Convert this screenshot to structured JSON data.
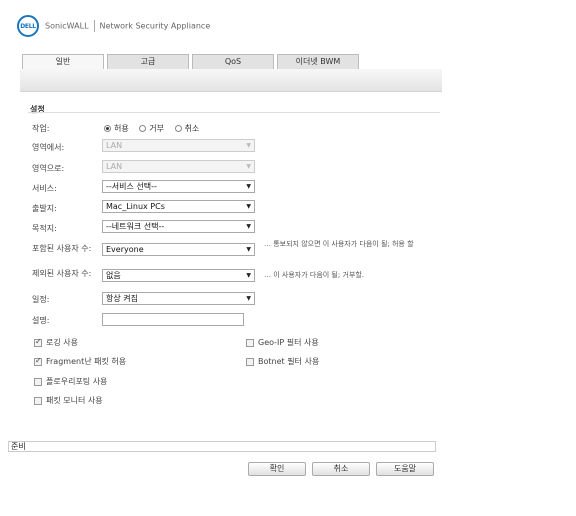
{
  "header": {
    "logo_text": "DELL",
    "brand": "SonicWALL",
    "product": "Network Security Appliance"
  },
  "tabs": [
    {
      "label": "일반"
    },
    {
      "label": "고급"
    },
    {
      "label": "QoS"
    },
    {
      "label": "이더넷 BWM"
    }
  ],
  "section": {
    "title": "설정"
  },
  "form": {
    "action": {
      "label": "작업:",
      "options": [
        "허용",
        "거부",
        "취소"
      ],
      "selected": "허용"
    },
    "from_zone": {
      "label": "영역에서:",
      "value": "LAN"
    },
    "to_zone": {
      "label": "영역으로:",
      "value": "LAN"
    },
    "service": {
      "label": "서비스:",
      "value": "--서비스 선택--"
    },
    "source": {
      "label": "출발지:",
      "value": "Mac_Linux PCs"
    },
    "destination": {
      "label": "목적지:",
      "value": "--네트워크 선택--"
    },
    "users_included": {
      "label": "포함된 사용자 수:",
      "value": "Everyone",
      "hint": "… 통보되지 않으면 이 사용자가 다음이 될; 허용 할"
    },
    "users_excluded": {
      "label": "제외된 사용자 수:",
      "value": "없음",
      "hint": "… 이 사용자가 다음이 될; 거부할."
    },
    "schedule": {
      "label": "일정:",
      "value": "항상 켜짐"
    },
    "comment": {
      "label": "설명:",
      "value": ""
    }
  },
  "checkboxes": {
    "logging": {
      "label": "로깅 사용",
      "checked": true
    },
    "fragment": {
      "label": "Fragment난 패킷 허용",
      "checked": true
    },
    "flow": {
      "label": "플로우리포팅 사용",
      "checked": false
    },
    "packet_monitor": {
      "label": "패킷 모니터 사용",
      "checked": false
    },
    "geoip": {
      "label": "Geo-IP 필터 사용",
      "checked": false
    },
    "botnet": {
      "label": "Botnet 필터 사용",
      "checked": false
    }
  },
  "status": {
    "text": "준비"
  },
  "buttons": {
    "ok": "확인",
    "cancel": "취소",
    "help": "도움말"
  },
  "colors": {
    "accent": "#1b75bc"
  }
}
